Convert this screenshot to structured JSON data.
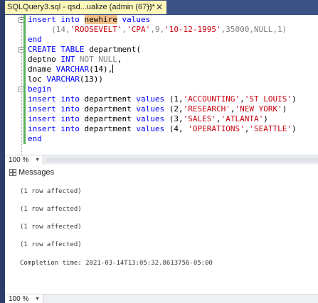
{
  "tab": {
    "title": "SQLQuery3.sql - qsd...ualize (admin (67))*",
    "pin": "⊣",
    "close": "✕"
  },
  "editor": {
    "lines": [
      {
        "parts": [
          {
            "t": "insert",
            "c": "kw"
          },
          {
            "t": " "
          },
          {
            "t": "into",
            "c": "kw"
          },
          {
            "t": " "
          },
          {
            "t": "newhire",
            "c": "hl"
          },
          {
            "t": " "
          },
          {
            "t": "values",
            "c": "kw"
          }
        ]
      },
      {
        "parts": [
          {
            "t": "     (14,",
            "c": "gray"
          },
          {
            "t": "'ROOSEVELT'",
            "c": "str"
          },
          {
            "t": ",",
            "c": "gray"
          },
          {
            "t": "'CPA'",
            "c": "str"
          },
          {
            "t": ",9,",
            "c": "gray"
          },
          {
            "t": "'10-12-1995'",
            "c": "str"
          },
          {
            "t": ",35000,",
            "c": "gray"
          },
          {
            "t": "NULL",
            "c": "gray"
          },
          {
            "t": ",1)",
            "c": "gray"
          }
        ]
      },
      {
        "parts": [
          {
            "t": "end",
            "c": "kw"
          }
        ]
      },
      {
        "parts": [
          {
            "t": "CREATE",
            "c": "kw"
          },
          {
            "t": " "
          },
          {
            "t": "TABLE",
            "c": "kw"
          },
          {
            "t": " department("
          }
        ]
      },
      {
        "parts": [
          {
            "t": "deptno "
          },
          {
            "t": "INT",
            "c": "kw"
          },
          {
            "t": " "
          },
          {
            "t": "NOT NULL",
            "c": "gray"
          },
          {
            "t": ","
          }
        ]
      },
      {
        "parts": [
          {
            "t": "dname "
          },
          {
            "t": "VARCHAR",
            "c": "kw"
          },
          {
            "t": "(14),"
          }
        ]
      },
      {
        "parts": [
          {
            "t": "loc "
          },
          {
            "t": "VARCHAR",
            "c": "kw"
          },
          {
            "t": "(13))"
          }
        ]
      },
      {
        "parts": [
          {
            "t": "begin",
            "c": "kw"
          }
        ]
      },
      {
        "parts": [
          {
            "t": "insert",
            "c": "kw"
          },
          {
            "t": " "
          },
          {
            "t": "into",
            "c": "kw"
          },
          {
            "t": " department "
          },
          {
            "t": "values",
            "c": "kw"
          },
          {
            "t": " (1,"
          },
          {
            "t": "'ACCOUNTING'",
            "c": "str"
          },
          {
            "t": ","
          },
          {
            "t": "'ST LOUIS'",
            "c": "str"
          },
          {
            "t": ")"
          }
        ]
      },
      {
        "parts": [
          {
            "t": "insert",
            "c": "kw"
          },
          {
            "t": " "
          },
          {
            "t": "into",
            "c": "kw"
          },
          {
            "t": " department "
          },
          {
            "t": "values",
            "c": "kw"
          },
          {
            "t": " (2,"
          },
          {
            "t": "'RESEARCH'",
            "c": "str"
          },
          {
            "t": ","
          },
          {
            "t": "'NEW YORK'",
            "c": "str"
          },
          {
            "t": ")"
          }
        ]
      },
      {
        "parts": [
          {
            "t": "insert",
            "c": "kw"
          },
          {
            "t": " "
          },
          {
            "t": "into",
            "c": "kw"
          },
          {
            "t": " department "
          },
          {
            "t": "values",
            "c": "kw"
          },
          {
            "t": " (3,"
          },
          {
            "t": "'SALES'",
            "c": "str"
          },
          {
            "t": ","
          },
          {
            "t": "'ATLANTA'",
            "c": "str"
          },
          {
            "t": ")"
          }
        ]
      },
      {
        "parts": [
          {
            "t": "insert",
            "c": "kw"
          },
          {
            "t": " "
          },
          {
            "t": "into",
            "c": "kw"
          },
          {
            "t": " department "
          },
          {
            "t": "values",
            "c": "kw"
          },
          {
            "t": " (4, "
          },
          {
            "t": "'OPERATIONS'",
            "c": "str"
          },
          {
            "t": ","
          },
          {
            "t": "'SEATTLE'",
            "c": "str"
          },
          {
            "t": ")"
          }
        ]
      },
      {
        "parts": [
          {
            "t": "end",
            "c": "kw"
          }
        ]
      }
    ]
  },
  "zoom_top": "100 %",
  "zoom_bottom": "100 %",
  "messages_title": "Messages",
  "messages": [
    "(1 row affected)",
    "(1 row affected)",
    "(1 row affected)",
    "(1 row affected)",
    "Completion time: 2021-03-14T13:05:32.8613756-05:00"
  ],
  "colors": {
    "keyword": "#0000ff",
    "string": "#c8000f",
    "highlight": "#f3c08a",
    "tab_active": "#fef7ba",
    "tab_bar": "#3c5186"
  }
}
